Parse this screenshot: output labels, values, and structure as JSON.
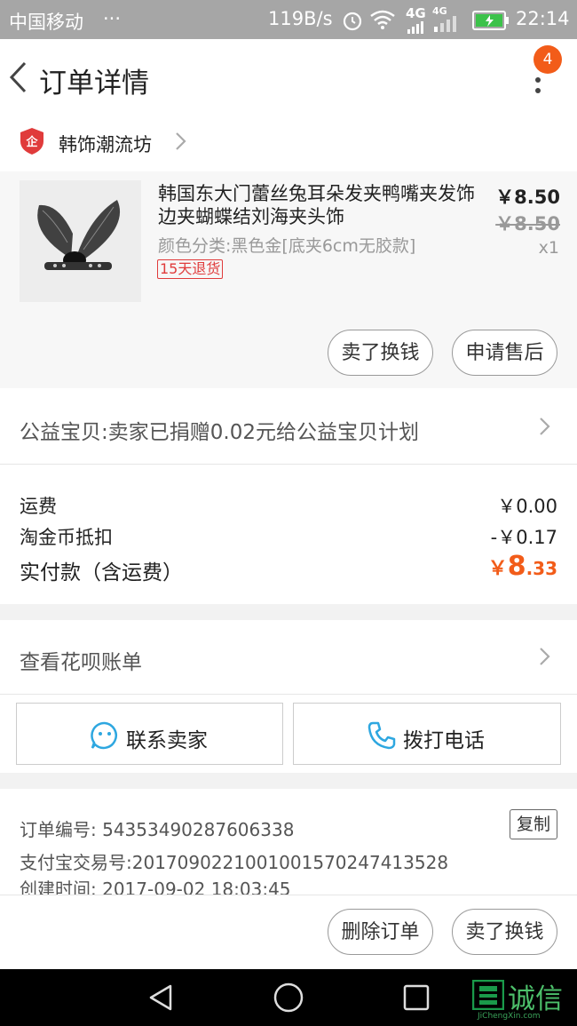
{
  "status_bar": {
    "carrier": "中国移动",
    "dots": "···",
    "speed": "119B/s",
    "network": "4G",
    "network2": "4G",
    "time": "22:14"
  },
  "header": {
    "title": "订单详情",
    "badge_count": "4"
  },
  "shop": {
    "icon_text": "企",
    "name": "韩饰潮流坊"
  },
  "product": {
    "title": "韩国东大门蕾丝兔耳朵发夹鸭嘴夹发饰边夹蝴蝶结刘海夹头饰",
    "spec": "颜色分类:黑色金[底夹6cm无胶款]",
    "return_tag": "15天退货",
    "price": "￥8.50",
    "original_price": "￥8.50",
    "quantity": "x1",
    "actions": {
      "sell_label": "卖了换钱",
      "aftersale_label": "申请售后"
    }
  },
  "charity": {
    "text": "公益宝贝:卖家已捐赠0.02元给公益宝贝计划"
  },
  "fees": {
    "shipping_label": "运费",
    "shipping_value": "￥0.00",
    "coin_label": "淘金币抵扣",
    "coin_value": "-￥0.17",
    "total_label": "实付款（含运费）",
    "total_currency": "￥",
    "total_int": "8",
    "total_dec": ".33"
  },
  "huabei": {
    "text": "查看花呗账单"
  },
  "contact": {
    "seller_label": "联系卖家",
    "call_label": "拨打电话"
  },
  "order_info": {
    "number_label": "订单编号:",
    "number_value": "54353490287606338",
    "copy_label": "复制",
    "alipay_label": "支付宝交易号:",
    "alipay_value": "2017090221001001570247413528",
    "created_label": "创建时间:",
    "created_value": "2017-09-02 18:03:45"
  },
  "footer": {
    "delete_label": "删除订单",
    "sell_label": "卖了换钱"
  },
  "watermark": {
    "brand": "诚信",
    "domain": "JiChengXin.com"
  },
  "colors": {
    "accent": "#f25c19",
    "status_bar": "#a6a6a6",
    "tag_red": "#e03b3b"
  }
}
